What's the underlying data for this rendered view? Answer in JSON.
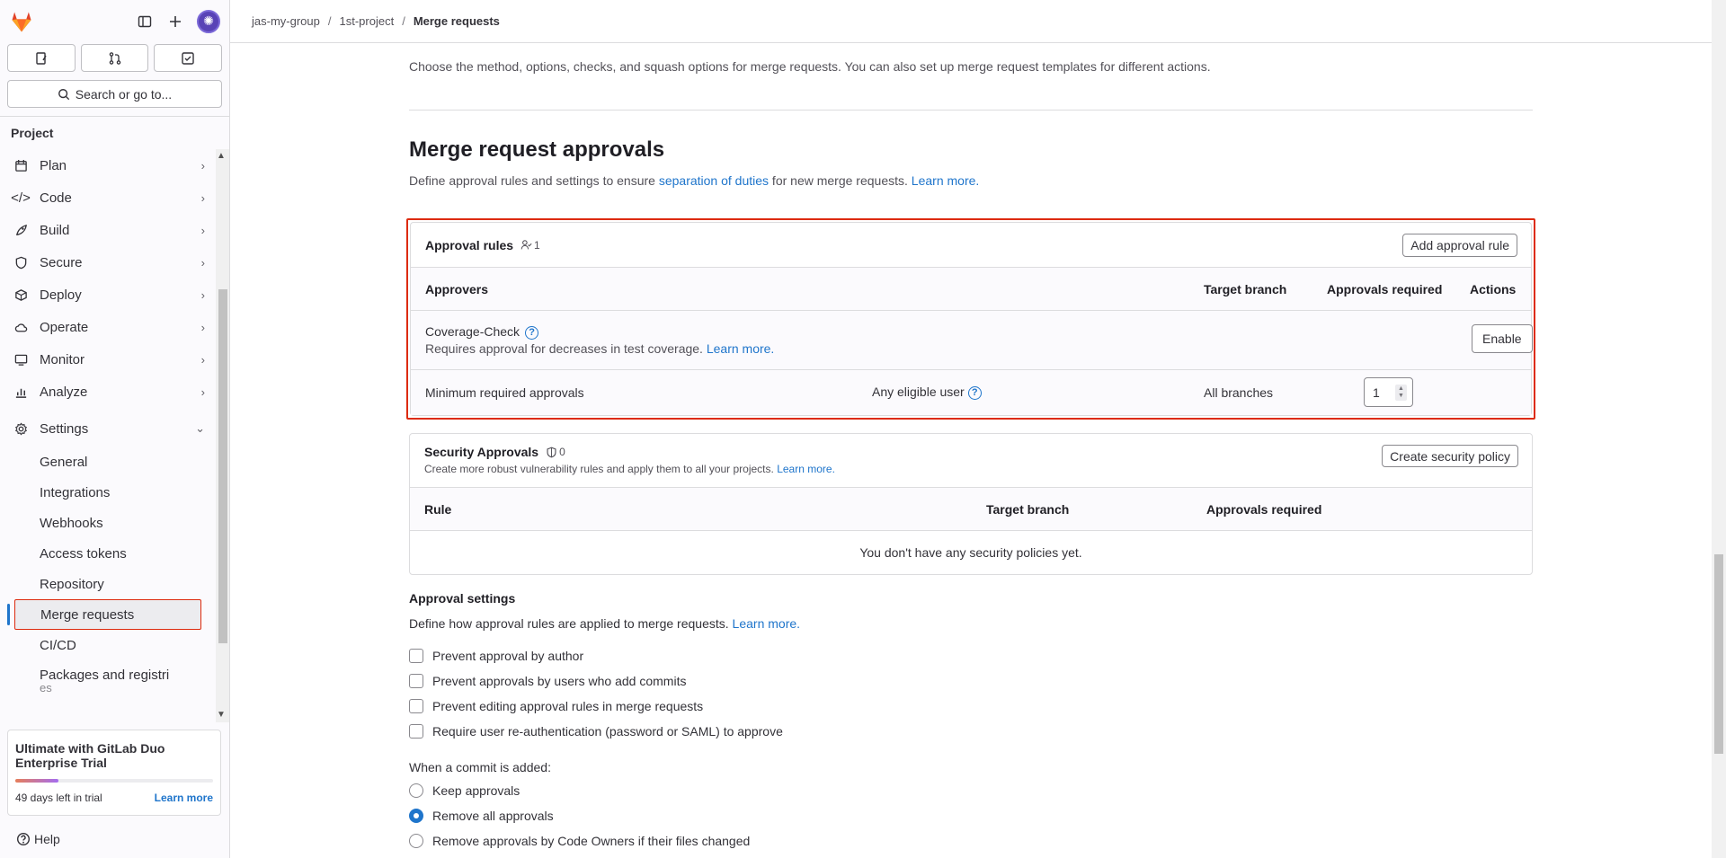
{
  "sidebar": {
    "search_label": "Search or go to...",
    "section_title": "Project",
    "nav": [
      {
        "label": "Plan",
        "icon": "plan-icon"
      },
      {
        "label": "Code",
        "icon": "code-icon"
      },
      {
        "label": "Build",
        "icon": "rocket-icon"
      },
      {
        "label": "Secure",
        "icon": "shield-icon"
      },
      {
        "label": "Deploy",
        "icon": "deploy-icon"
      },
      {
        "label": "Operate",
        "icon": "cloud-icon"
      },
      {
        "label": "Monitor",
        "icon": "monitor-icon"
      },
      {
        "label": "Analyze",
        "icon": "chart-icon"
      },
      {
        "label": "Settings",
        "icon": "gear-icon"
      }
    ],
    "settings_items": [
      "General",
      "Integrations",
      "Webhooks",
      "Access tokens",
      "Repository",
      "Merge requests",
      "CI/CD",
      "Packages and registri",
      "es"
    ],
    "trial": {
      "title": "Ultimate with GitLab Duo Enterprise Trial",
      "days_left": "49 days left in trial",
      "learn_more": "Learn more",
      "progress": 0.22
    },
    "help": "Help"
  },
  "breadcrumb": [
    "jas-my-group",
    "1st-project",
    "Merge requests"
  ],
  "intro_text": "Choose the method, options, checks, and squash options for merge requests. You can also set up merge request templates for different actions.",
  "approvals": {
    "title": "Merge request approvals",
    "desc_pre": "Define approval rules and settings to ensure ",
    "desc_link": "separation of duties",
    "desc_post": " for new merge requests. ",
    "learn_more": "Learn more.",
    "rules_card": {
      "title": "Approval rules",
      "count": "1",
      "add_button": "Add approval rule",
      "columns": [
        "Approvers",
        "Target branch",
        "Approvals required",
        "Actions"
      ],
      "coverage": {
        "name": "Coverage-Check",
        "desc": "Requires approval for decreases in test coverage.",
        "link": "Learn more.",
        "action": "Enable"
      },
      "min_row": {
        "name": "Minimum required approvals",
        "approvers": "Any eligible user",
        "branch": "All branches",
        "required": "1"
      }
    },
    "security_card": {
      "title": "Security Approvals",
      "count": "0",
      "subtitle": "Create more robust vulnerability rules and apply them to all your projects.",
      "link": "Learn more.",
      "button": "Create security policy",
      "columns": [
        "Rule",
        "Target branch",
        "Approvals required"
      ],
      "empty": "You don't have any security policies yet."
    },
    "settings": {
      "title": "Approval settings",
      "desc": "Define how approval rules are applied to merge requests.",
      "learn_more": "Learn more.",
      "checkboxes": [
        "Prevent approval by author",
        "Prevent approvals by users who add commits",
        "Prevent editing approval rules in merge requests",
        "Require user re-authentication (password or SAML) to approve"
      ],
      "commit_label": "When a commit is added:",
      "radios": [
        "Keep approvals",
        "Remove all approvals",
        "Remove approvals by Code Owners if their files changed"
      ],
      "selected_radio": "Remove all approvals"
    }
  }
}
